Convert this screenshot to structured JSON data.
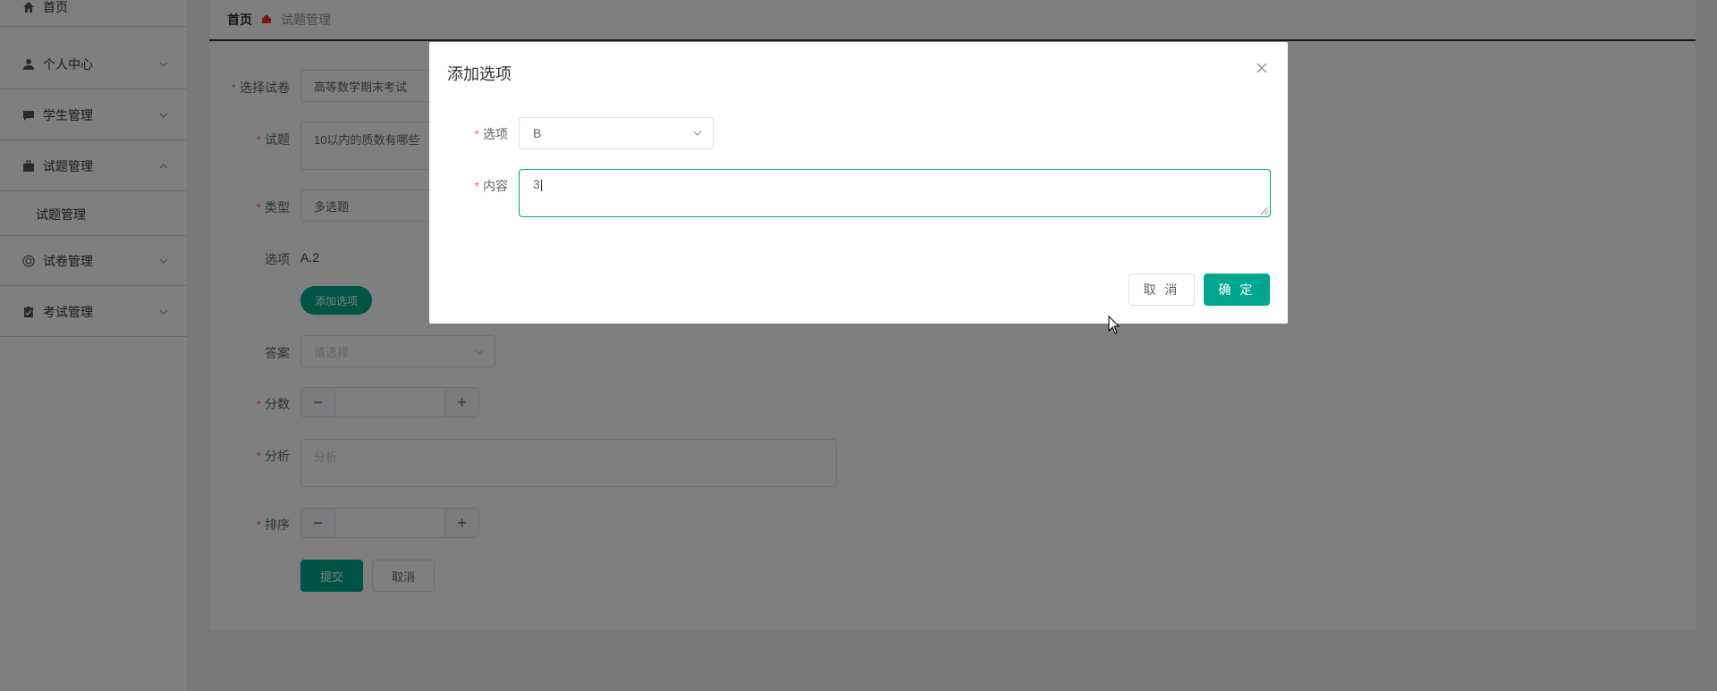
{
  "sidebar": {
    "items": [
      {
        "label": "首页",
        "icon": "home-icon"
      },
      {
        "label": "个人中心",
        "icon": "user-icon"
      },
      {
        "label": "学生管理",
        "icon": "chat-icon"
      },
      {
        "label": "试题管理",
        "icon": "briefcase-icon"
      },
      {
        "label": "试卷管理",
        "icon": "circle-icon"
      },
      {
        "label": "考试管理",
        "icon": "clipboard-icon"
      }
    ],
    "submenu": {
      "label": "试题管理"
    }
  },
  "breadcrumb": {
    "home": "首页",
    "current": "试题管理"
  },
  "form": {
    "paper_label": "选择试卷",
    "paper_value": "高等数学期末考试",
    "question_label": "试题",
    "question_value": "10以内的质数有哪些",
    "type_label": "类型",
    "type_value": "多选题",
    "options_label": "选项",
    "options_value": "A.2",
    "add_option_button": "添加选项",
    "answer_label": "答案",
    "answer_placeholder": "请选择",
    "score_label": "分数",
    "analysis_label": "分析",
    "analysis_placeholder": "分析",
    "order_label": "排序",
    "stepper_minus": "−",
    "stepper_plus": "+",
    "submit_button": "提交",
    "cancel_button": "取消"
  },
  "dialog": {
    "title": "添加选项",
    "option_label": "选项",
    "option_value": "B",
    "content_label": "内容",
    "content_value": "3",
    "cancel_button": "取 消",
    "confirm_button": "确 定"
  },
  "colors": {
    "accent": "#00a78e",
    "required": "#f56c6c"
  }
}
